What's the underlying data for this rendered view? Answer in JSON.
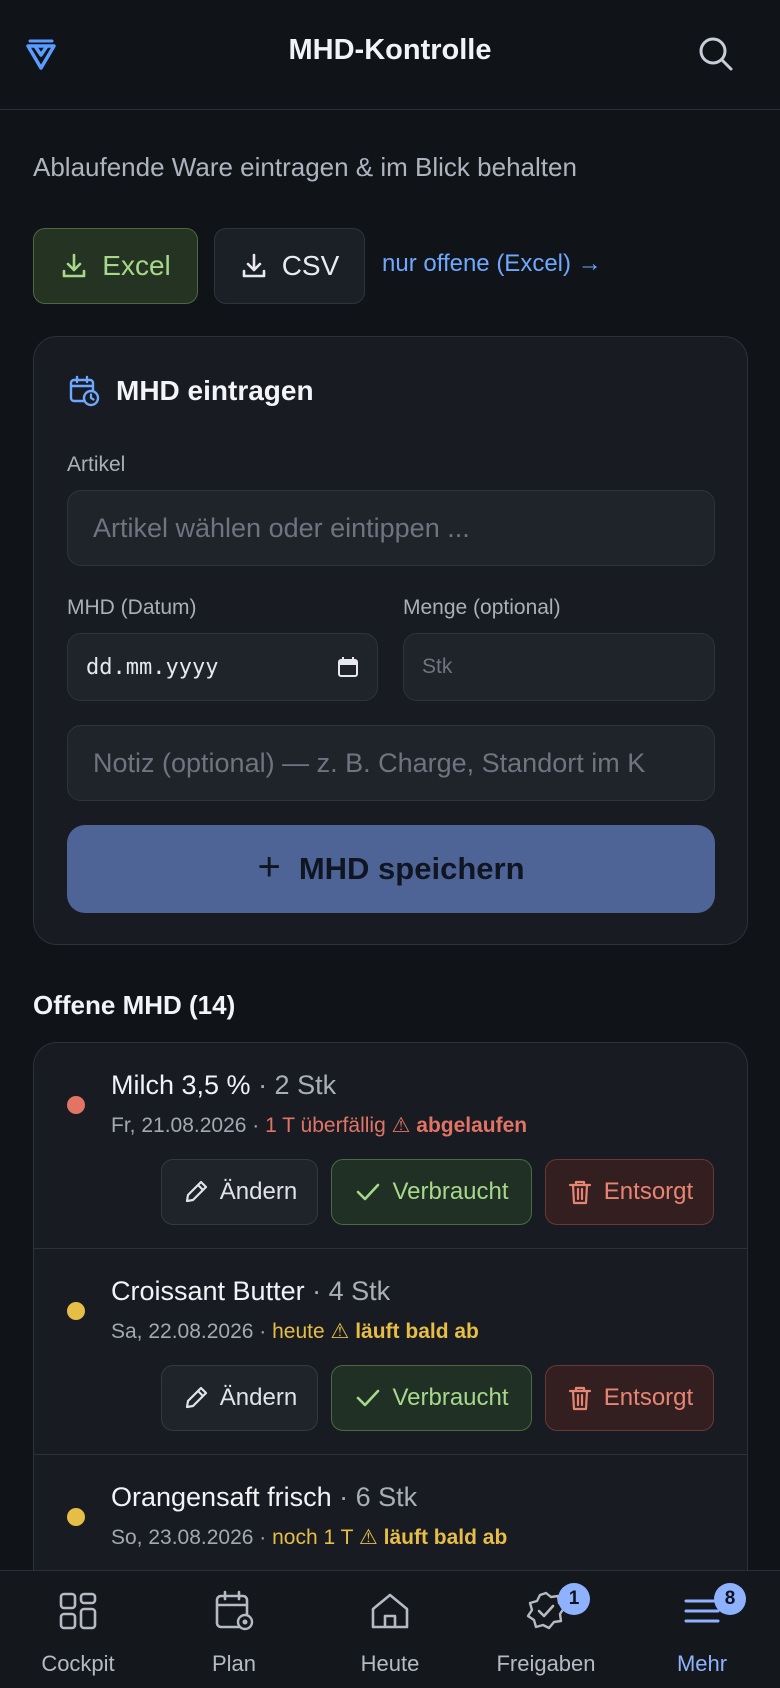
{
  "header": {
    "title": "MHD-Kontrolle",
    "logo_icon": "shield-v-icon",
    "search_icon": "search-icon"
  },
  "subtitle": "Ablaufende Ware eintragen & im Blick behalten",
  "export": {
    "excel_label": "Excel",
    "csv_label": "CSV",
    "open_link": "nur offene (Excel) →"
  },
  "form": {
    "title": "MHD eintragen",
    "artikel_label": "Artikel",
    "artikel_placeholder": "Artikel wählen oder eintippen ...",
    "mhd_label": "MHD (Datum)",
    "mhd_value": "dd.mm.yyyy",
    "menge_label": "Menge (optional)",
    "menge_placeholder": "Stk",
    "notiz_placeholder": "Notiz (optional) — z. B. Charge, Standort im K",
    "save_label": "MHD speichern"
  },
  "list": {
    "title": "Offene MHD (14)",
    "items": [
      {
        "name": "Milch 3,5 %",
        "qty": " · 2 Stk",
        "date": "Fr, 21.08.2026 · ",
        "status": "1 T überfällig",
        "warn": "abgelaufen",
        "color": "#e27465"
      },
      {
        "name": "Croissant Butter",
        "qty": " · 4 Stk",
        "date": "Sa, 22.08.2026 · ",
        "status": "heute",
        "warn": "läuft bald ab",
        "color": "#e6bd45"
      },
      {
        "name": "Orangensaft frisch",
        "qty": " · 6 Stk",
        "date": "So, 23.08.2026 · ",
        "status": "noch 1 T",
        "warn": "läuft bald ab",
        "color": "#e6bd45"
      }
    ],
    "actions": {
      "edit": "Ändern",
      "used": "Verbraucht",
      "dispose": "Entsorgt"
    }
  },
  "nav": {
    "items": [
      {
        "label": "Cockpit",
        "icon": "grid-icon"
      },
      {
        "label": "Plan",
        "icon": "calendar-gear-icon"
      },
      {
        "label": "Heute",
        "icon": "home-icon"
      },
      {
        "label": "Freigaben",
        "icon": "badge-check-icon",
        "badge": "1"
      },
      {
        "label": "Mehr",
        "icon": "menu-icon",
        "badge": "8"
      }
    ]
  }
}
